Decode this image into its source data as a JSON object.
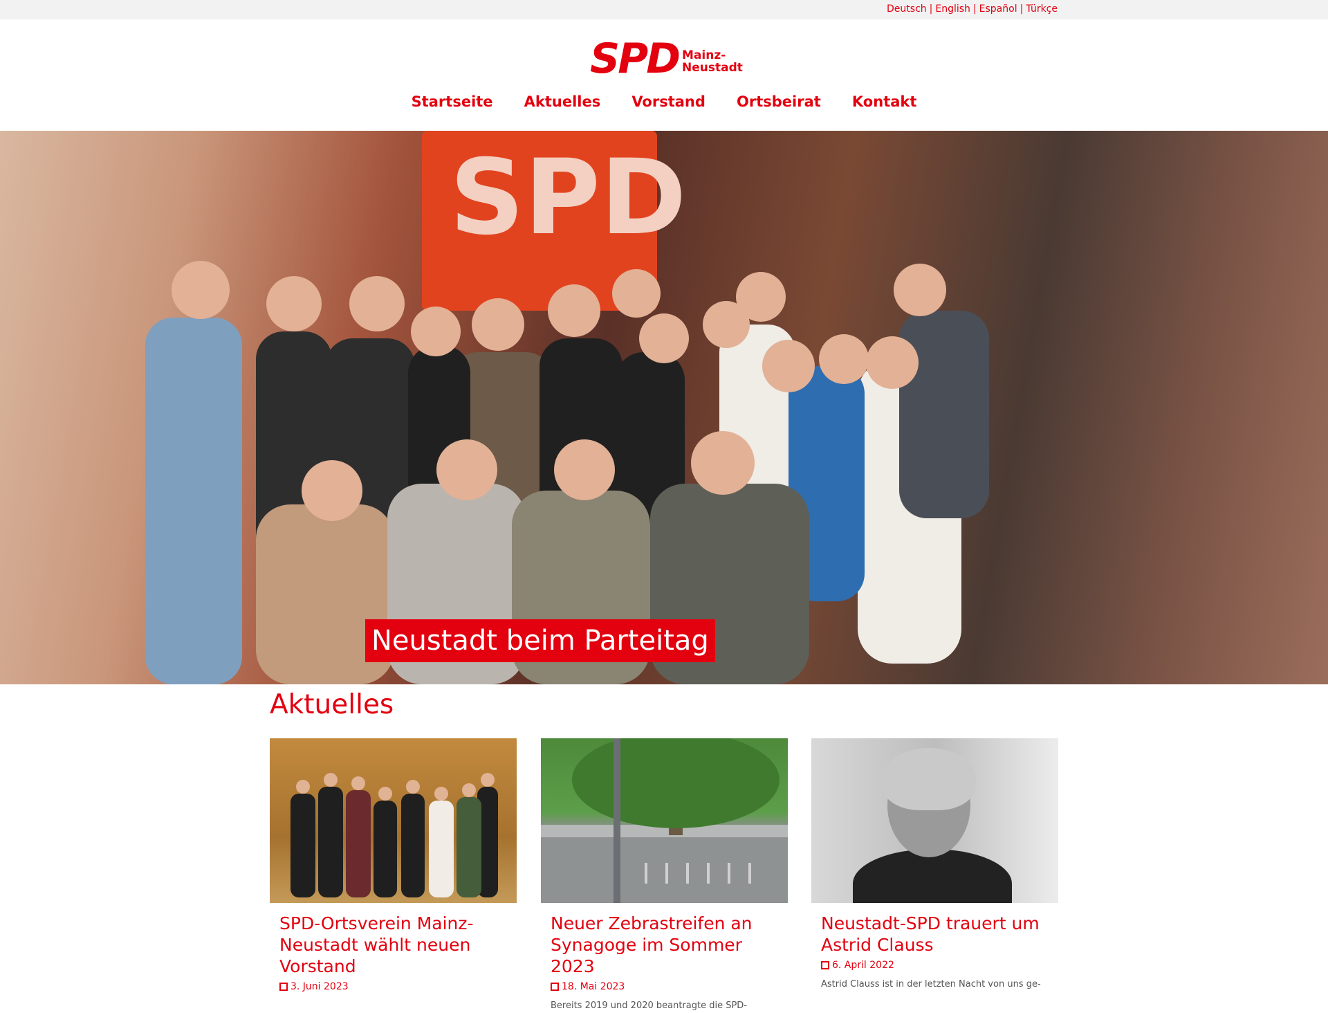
{
  "languages": [
    "Deutsch",
    "English",
    "Español",
    "Türkçe"
  ],
  "logo": {
    "brand": "SPD",
    "place_line1": "Mainz-",
    "place_line2": "Neustadt"
  },
  "nav": [
    "Startseite",
    "Aktuelles",
    "Vorstand",
    "Ortsbeirat",
    "Kontakt"
  ],
  "hero": {
    "caption": "Neustadt beim Parteitag",
    "wall_text": "SPD"
  },
  "section": {
    "title": "Aktuelles"
  },
  "cards": [
    {
      "title": "SPD-Ortsverein Mainz-Neustadt wählt neuen Vorstand",
      "date": "3. Juni 2023",
      "teaser": ""
    },
    {
      "title": "Neuer Zebrastreifen an Synagoge im Sommer 2023",
      "date": "18. Mai 2023",
      "teaser": "Bereits 2019 und 2020 beantragte die SPD-"
    },
    {
      "title": "Neustadt-SPD trauert um Astrid Clauss",
      "date": "6. April 2022",
      "teaser": "Astrid Clauss ist in der letzten Nacht von uns ge-"
    }
  ],
  "colors": {
    "brand_red": "#e3000f"
  }
}
